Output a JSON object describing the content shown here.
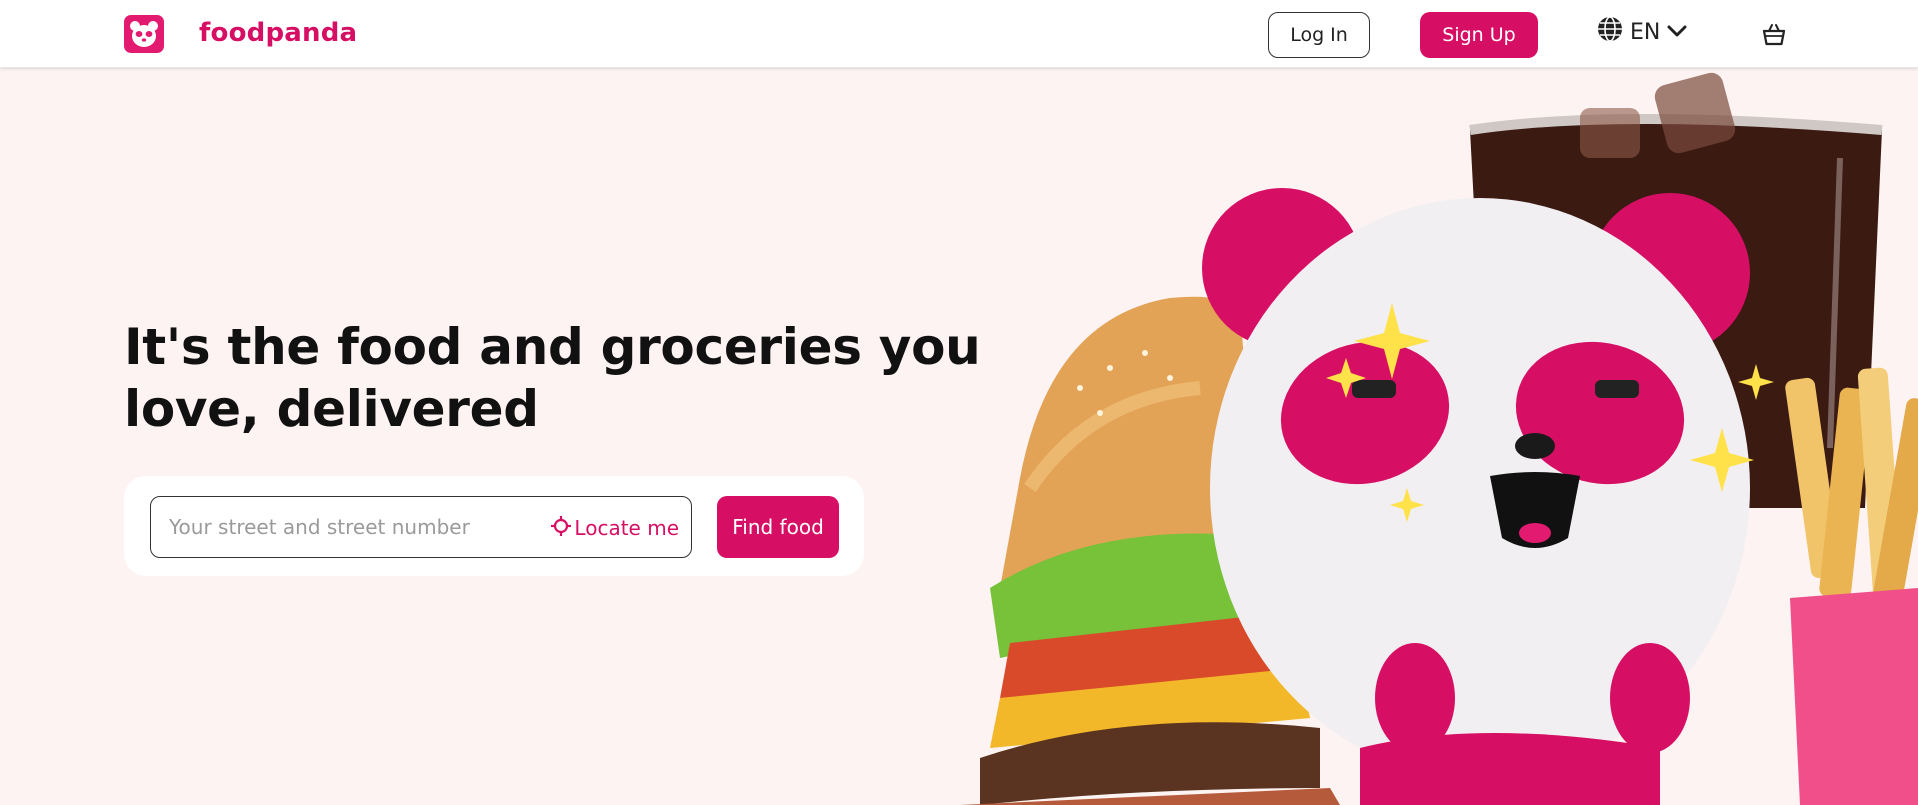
{
  "header": {
    "brand": "foodpanda",
    "login_label": "Log In",
    "signup_label": "Sign Up",
    "language": "EN",
    "icons": [
      "foodpanda-logo-icon",
      "globe-icon",
      "chevron-down-icon",
      "shopping-basket-icon"
    ]
  },
  "hero": {
    "title": "It's the food and groceries you love, delivered",
    "address_placeholder": "Your street and street number",
    "address_value": "",
    "locate_label": "Locate me",
    "find_label": "Find food",
    "icons": [
      "crosshair-icon"
    ]
  },
  "colors": {
    "brand": "#d70f64",
    "background": "#fdf3f2",
    "header_bg": "#ffffff"
  }
}
